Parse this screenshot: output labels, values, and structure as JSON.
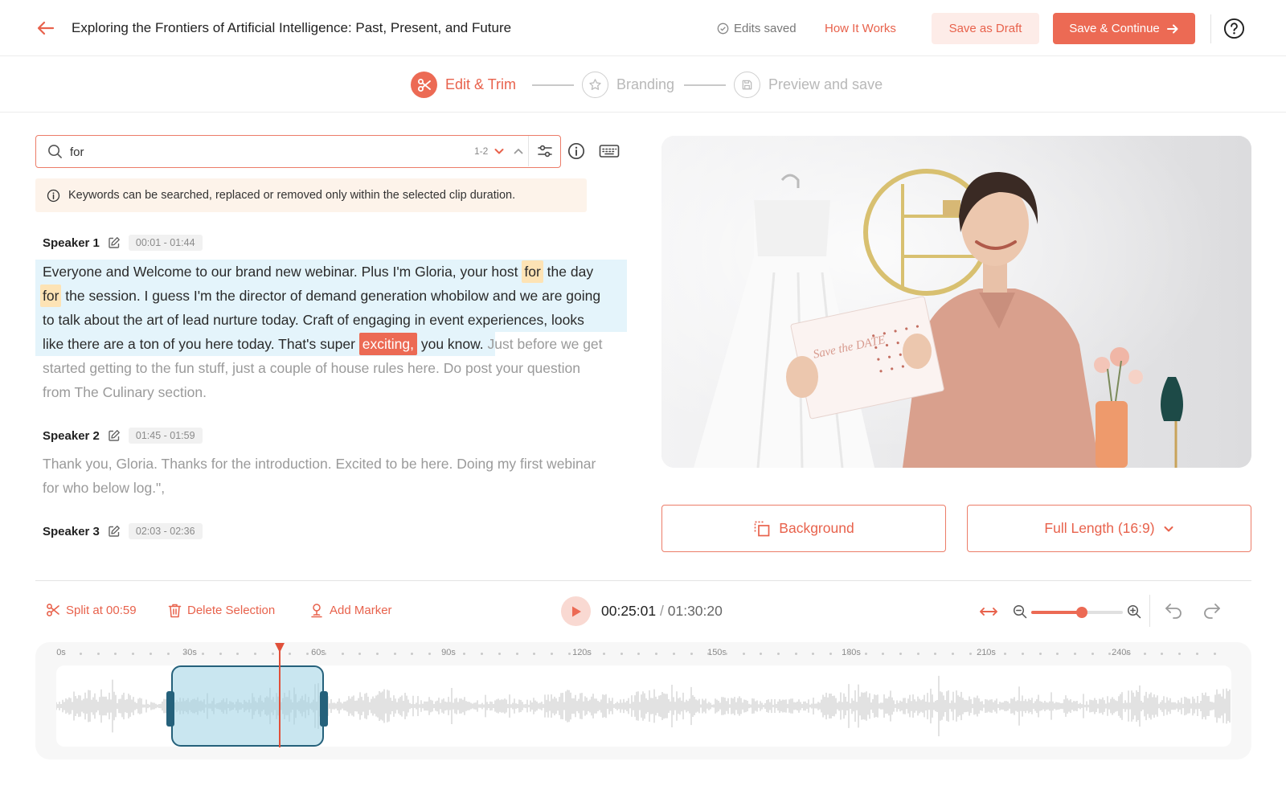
{
  "header": {
    "title": "Exploring the Frontiers of Artificial Intelligence: Past, Present, and Future",
    "status": "Edits saved",
    "how_link": "How It Works",
    "draft_label": "Save as Draft",
    "continue_label": "Save & Continue"
  },
  "stepper": {
    "steps": [
      {
        "label": "Edit & Trim",
        "icon": "scissors-icon",
        "state": "active"
      },
      {
        "label": "Branding",
        "icon": "star-icon",
        "state": "idle"
      },
      {
        "label": "Preview and save",
        "icon": "save-icon",
        "state": "idle"
      }
    ]
  },
  "search": {
    "value": "for",
    "match_count": "1-2"
  },
  "notice": "Keywords can be searched, replaced or removed only within the selected clip duration.",
  "transcript": {
    "speakers": [
      {
        "name": "Speaker 1",
        "time": "00:01 - 01:44",
        "lines": [
          {
            "pre": "Everyone and Welcome to our brand new webinar. Plus I'm Gloria, your host ",
            "kw": "for",
            "post": " the day"
          },
          {
            "kw": "for",
            "post": " the session. I guess I'm the director of demand generation whobilow and we are going"
          },
          {
            "post": "to talk about the art of lead nurture today. Craft of engaging in event experiences, looks"
          },
          {
            "pre": "like there are a ton of you here today. That's super ",
            "kw_active": "exciting,",
            "mid": " you know. ",
            "post_gray": "Just before we get"
          },
          {
            "post_gray": "started getting to the fun stuff, just a couple of house rules here. Do post your question"
          },
          {
            "post_gray": "from The Culinary section."
          }
        ]
      },
      {
        "name": "Speaker 2",
        "time": "01:45 - 01:59",
        "lines": [
          "Thank you, Gloria. Thanks for the introduction. Excited to be here. Doing my first webinar",
          "for who below log.\","
        ]
      },
      {
        "name": "Speaker 3",
        "time": "02:03 - 02:36"
      }
    ]
  },
  "video": {
    "card_text": "Save the DATE"
  },
  "options": {
    "background_label": "Background",
    "aspect_label": "Full Length (16:9)"
  },
  "toolbar": {
    "split_label": "Split at 00:59",
    "delete_label": "Delete Selection",
    "marker_label": "Add Marker",
    "current_time": "00:25:01",
    "separator": "/",
    "total_time": "01:30:20",
    "zoom_level": 0.55
  },
  "timeline": {
    "ticks": [
      "0s",
      "30s",
      "60s",
      "90s",
      "120s",
      "150s",
      "180s",
      "210s",
      "240s"
    ]
  },
  "colors": {
    "accent": "#ec6a54",
    "selection": "#25617b",
    "highlight": "#e4f4fb"
  }
}
